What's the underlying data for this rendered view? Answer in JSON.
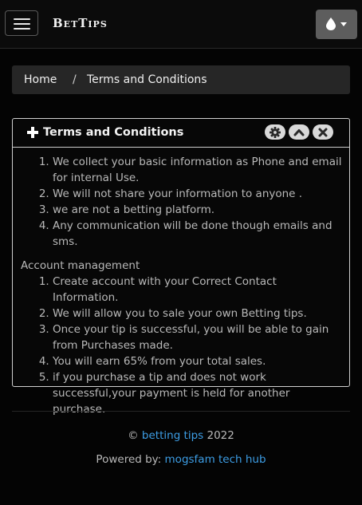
{
  "navbar": {
    "brand": "BetTips",
    "menu_icon": "hamburger-menu-icon",
    "theme_icon": "droplet-icon",
    "theme_caret_icon": "caret-down-icon",
    "theme_button_color": "#5d5d5d"
  },
  "breadcrumb": {
    "home": "Home",
    "separator": "/",
    "current": "Terms and Conditions"
  },
  "card": {
    "title": "Terms and Conditions",
    "title_icon": "plus-icon",
    "tools": [
      "gear-icon",
      "chevron-up-icon",
      "close-icon"
    ],
    "terms": [
      "We collect your basic information as Phone and email for internal Use.",
      "We will not share your information to anyone .",
      "we are not a betting platform.",
      "Any communication will be done though emails and sms."
    ],
    "account_heading": "Account management",
    "account_items": [
      "Create account with your Correct Contact Information.",
      "We will allow you to sale your own Betting tips.",
      "Once your tip is successful, you will be able to gain from Purchases made.",
      "You will earn 65% from your total sales.",
      "if you purchase a tip and does not work successful,your payment is held for another purchase."
    ]
  },
  "footer": {
    "copyright_symbol": "©",
    "site_link": "betting tips",
    "year": "2022",
    "powered_label": "Powered by:",
    "powered_link": "mogsfam tech hub",
    "link_color": "#3d9ee6"
  }
}
